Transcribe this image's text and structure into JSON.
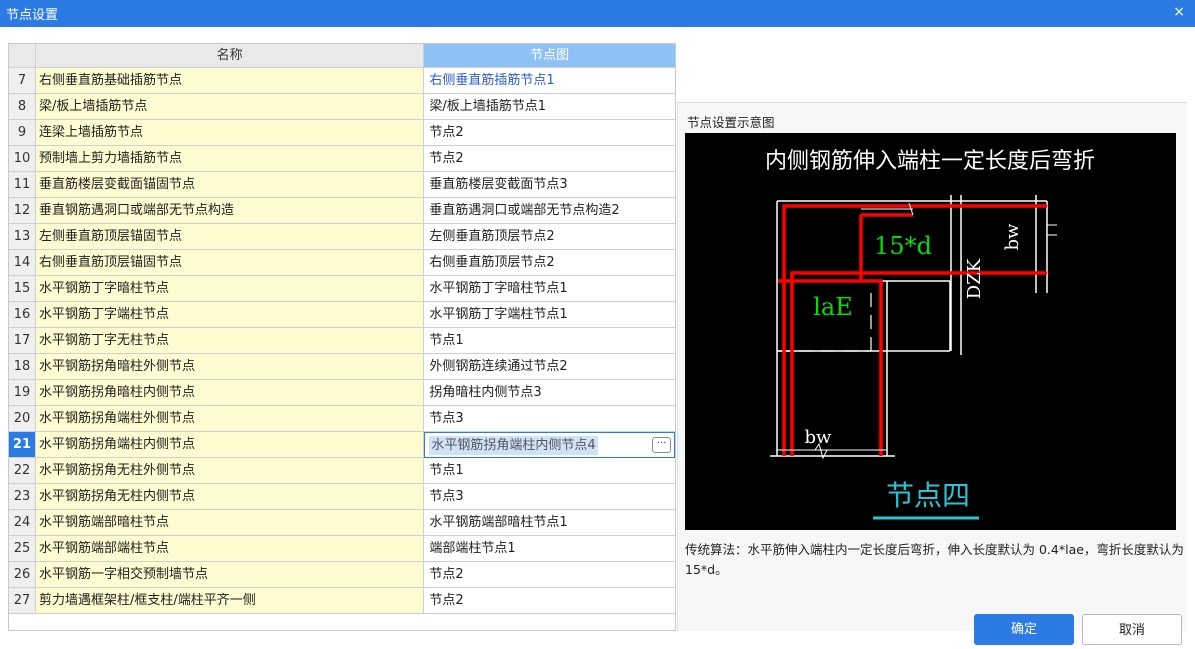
{
  "window": {
    "title": "节点设置",
    "close_glyph": "×"
  },
  "table": {
    "headers": {
      "name": "名称",
      "node": "节点图"
    },
    "rows": [
      {
        "num": "7",
        "name": "右侧垂直筋基础插筋节点",
        "node": "右侧垂直筋插筋节点1"
      },
      {
        "num": "8",
        "name": "梁/板上墙插筋节点",
        "node": "梁/板上墙插筋节点1"
      },
      {
        "num": "9",
        "name": "连梁上墙插筋节点",
        "node": "节点2"
      },
      {
        "num": "10",
        "name": "预制墙上剪力墙插筋节点",
        "node": "节点2"
      },
      {
        "num": "11",
        "name": "垂直筋楼层变截面锚固节点",
        "node": "垂直筋楼层变截面节点3"
      },
      {
        "num": "12",
        "name": "垂直钢筋遇洞口或端部无节点构造",
        "node": "垂直筋遇洞口或端部无节点构造2"
      },
      {
        "num": "13",
        "name": "左侧垂直筋顶层锚固节点",
        "node": "左侧垂直筋顶层节点2"
      },
      {
        "num": "14",
        "name": "右侧垂直筋顶层锚固节点",
        "node": "右侧垂直筋顶层节点2"
      },
      {
        "num": "15",
        "name": "水平钢筋丁字暗柱节点",
        "node": "水平钢筋丁字暗柱节点1"
      },
      {
        "num": "16",
        "name": "水平钢筋丁字端柱节点",
        "node": "水平钢筋丁字端柱节点1"
      },
      {
        "num": "17",
        "name": "水平钢筋丁字无柱节点",
        "node": "节点1"
      },
      {
        "num": "18",
        "name": "水平钢筋拐角暗柱外侧节点",
        "node": "外侧钢筋连续通过节点2"
      },
      {
        "num": "19",
        "name": "水平钢筋拐角暗柱内侧节点",
        "node": "拐角暗柱内侧节点3"
      },
      {
        "num": "20",
        "name": "水平钢筋拐角端柱外侧节点",
        "node": "节点3"
      },
      {
        "num": "21",
        "name": "水平钢筋拐角端柱内侧节点",
        "node": "水平钢筋拐角端柱内侧节点4"
      },
      {
        "num": "22",
        "name": "水平钢筋拐角无柱外侧节点",
        "node": "节点1"
      },
      {
        "num": "23",
        "name": "水平钢筋拐角无柱内侧节点",
        "node": "节点3"
      },
      {
        "num": "24",
        "name": "水平钢筋端部暗柱节点",
        "node": "水平钢筋端部暗柱节点1"
      },
      {
        "num": "25",
        "name": "水平钢筋端部端柱节点",
        "node": "端部端柱节点1"
      },
      {
        "num": "26",
        "name": "水平钢筋一字相交预制墙节点",
        "node": "节点2"
      },
      {
        "num": "27",
        "name": "剪力墙遇框架柱/框支柱/端柱平齐一侧",
        "node": "节点2"
      }
    ],
    "selected_num": "21",
    "ellipsis_glyph": "···"
  },
  "preview": {
    "title": "节点设置示意图",
    "diagram": {
      "heading": "内侧钢筋伸入端柱一定长度后弯折",
      "label_15d": "15*d",
      "label_lae": "laE",
      "label_dzk": "DZK",
      "label_bw_top": "bw",
      "label_bw_bottom": "bw",
      "caption": "节点四",
      "colors": {
        "bg": "#000000",
        "line": "#ffffff",
        "rebar": "#ff0000",
        "label": "#00e000",
        "caption": "#29c5d6"
      }
    },
    "description": "传统算法：水平筋伸入端柱内一定长度后弯折，伸入长度默认为 0.4*lae，弯折长度默认为 15*d。"
  },
  "buttons": {
    "ok": "确定",
    "cancel": "取消"
  },
  "colors": {
    "accent": "#2c7be5",
    "name_cell_bg": "#fdfbd0",
    "header_selected": "#8ec1f5"
  }
}
